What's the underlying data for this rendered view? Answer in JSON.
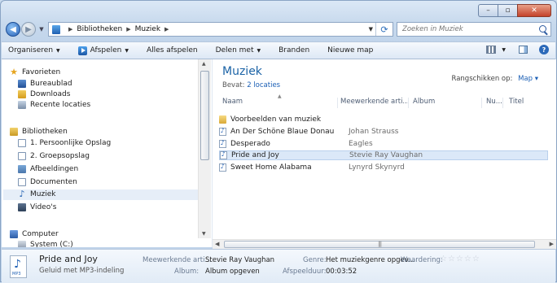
{
  "titlebar": {
    "min_label": "–",
    "max_label": "▫",
    "close_label": "✕"
  },
  "address": {
    "crumbs": [
      "Bibliotheken",
      "Muziek"
    ],
    "search_placeholder": "Zoeken in Muziek"
  },
  "toolbar": {
    "organize": "Organiseren",
    "play": "Afspelen",
    "play_all": "Alles afspelen",
    "share": "Delen met",
    "burn": "Branden",
    "new_folder": "Nieuwe map"
  },
  "nav": {
    "favorites_header": "Favorieten",
    "favorites": [
      "Bureaublad",
      "Downloads",
      "Recente locaties"
    ],
    "libraries_header": "Bibliotheken",
    "libraries": [
      "1. Persoonlijke Opslag",
      "2. Groepsopslag",
      "Afbeeldingen",
      "Documenten",
      "Muziek",
      "Video's"
    ],
    "selected": "Muziek",
    "computer_header": "Computer",
    "drives": [
      "System (C:)"
    ]
  },
  "library": {
    "title": "Muziek",
    "includes_label": "Bevat:",
    "includes_link": "2 locaties",
    "arrange_label": "Rangschikken op:",
    "arrange_value": "Map"
  },
  "columns": [
    "Naam",
    "Meewerkende arti...",
    "Album",
    "Nu...",
    "Titel"
  ],
  "files": [
    {
      "name": "Voorbeelden van muziek",
      "artist": "",
      "type": "folder"
    },
    {
      "name": "An Der Schöne Blaue Donau",
      "artist": "Johan Strauss",
      "type": "mp3"
    },
    {
      "name": "Desperado",
      "artist": "Eagles",
      "type": "mp3"
    },
    {
      "name": "Pride and Joy",
      "artist": "Stevie Ray Vaughan",
      "type": "mp3",
      "selected": true
    },
    {
      "name": "Sweet Home Alabama",
      "artist": "Lynyrd Skynyrd",
      "type": "mp3"
    }
  ],
  "details": {
    "thumb_label": "MP3",
    "title": "Pride and Joy",
    "type": "Geluid met MP3-indeling",
    "artist_label": "Meewerkende arti...",
    "artist_value": "Stevie Ray Vaughan",
    "album_label": "Album:",
    "album_value": "Album opgeven",
    "genre_label": "Genre:",
    "genre_value": "Het muziekgenre opgev...",
    "rating_label": "Waardering:",
    "rating_stars": "☆☆☆☆☆",
    "duration_label": "Afspeelduur:",
    "duration_value": "00:03:52"
  }
}
